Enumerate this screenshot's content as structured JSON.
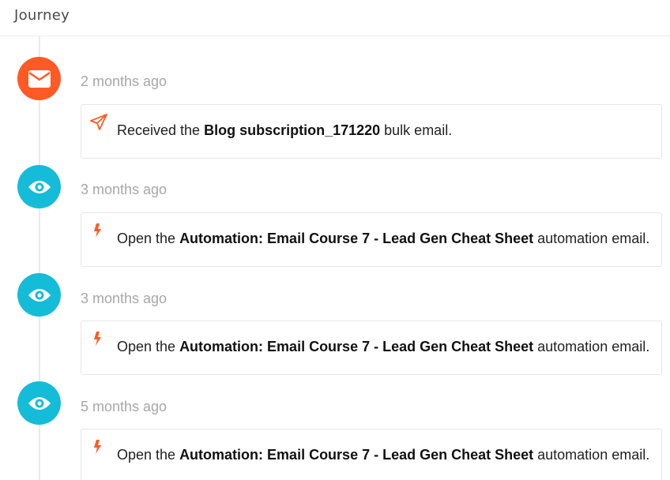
{
  "header": {
    "title": "Journey"
  },
  "events": [
    {
      "type": "email",
      "badge_icon": "envelope-icon",
      "time": "2 months ago",
      "action_icon": "paper-plane-icon",
      "prefix": "Received the ",
      "subject": "Blog subscription_171220",
      "suffix": " bulk email."
    },
    {
      "type": "view",
      "badge_icon": "eye-icon",
      "time": "3 months ago",
      "action_icon": "bolt-icon",
      "prefix": "Open the ",
      "subject": "Automation: Email Course 7 - Lead Gen Cheat Sheet",
      "suffix": " automation email."
    },
    {
      "type": "view",
      "badge_icon": "eye-icon",
      "time": "3 months ago",
      "action_icon": "bolt-icon",
      "prefix": "Open the ",
      "subject": "Automation: Email Course 7 - Lead Gen Cheat Sheet",
      "suffix": " automation email."
    },
    {
      "type": "view",
      "badge_icon": "eye-icon",
      "time": "5 months ago",
      "action_icon": "bolt-icon",
      "prefix": "Open the ",
      "subject": "Automation: Email Course 7 - Lead Gen Cheat Sheet",
      "suffix": " automation email."
    }
  ],
  "colors": {
    "email_badge": "#ff5a25",
    "view_badge": "#14bcd8",
    "action_icon": "#ff5a25",
    "time_text": "#a7a7a7"
  }
}
